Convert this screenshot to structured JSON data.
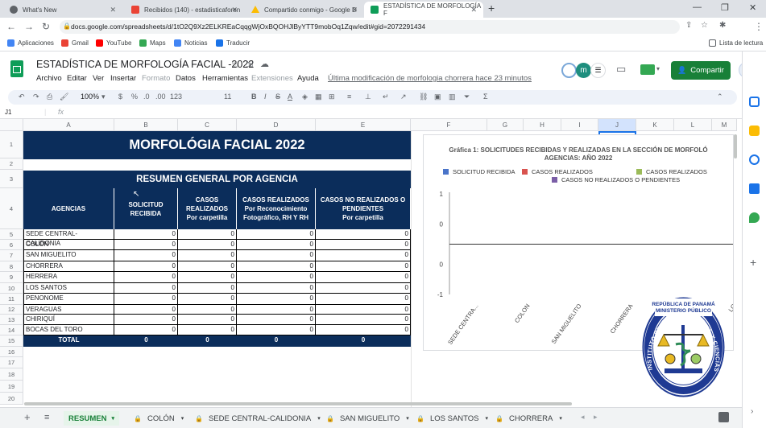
{
  "browser": {
    "tabs": [
      {
        "title": "What's New",
        "color": "#5f6368"
      },
      {
        "title": "Recibidos (140) - estadisticaforen",
        "color": "#ea4335"
      },
      {
        "title": "Compartido conmigo - Google D",
        "color": "#fbbc04"
      },
      {
        "title": "ESTADÍSTICA DE MORFOLOGÍA F",
        "color": "#0f9d58"
      }
    ],
    "url": "docs.google.com/spreadsheets/d/1tO2Q9Xz2ELKREaCqqgWjOxBQOHJlByYTT9mobOq1Zqw/edit#gid=2072291434",
    "bookmarks": [
      "Aplicaciones",
      "Gmail",
      "YouTube",
      "Maps",
      "Noticias",
      "Traducir"
    ],
    "reading_list": "Lista de lectura"
  },
  "sheets": {
    "title": "ESTADÍSTICA DE MORFOLOGÍA FACIAL -2022",
    "menus": [
      "Archivo",
      "Editar",
      "Ver",
      "Insertar",
      "Formato",
      "Datos",
      "Herramientas",
      "Extensiones",
      "Ayuda"
    ],
    "last_modified": "Última modificación de morfologia chorrera hace 23 minutos",
    "share_label": "Compartir",
    "zoom": "100%",
    "font_size": "11",
    "format_num": "123",
    "cell_ref": "J1",
    "fx": "fx"
  },
  "grid": {
    "columns": [
      "A",
      "B",
      "C",
      "D",
      "E",
      "F",
      "G",
      "H",
      "I",
      "J",
      "K",
      "L",
      "M"
    ],
    "rows": [
      "1",
      "2",
      "3",
      "4",
      "5",
      "6",
      "7",
      "8",
      "9",
      "10",
      "11",
      "12",
      "13",
      "14",
      "15",
      "16",
      "17",
      "18",
      "19",
      "20"
    ],
    "main_title": "MORFOLÓGIA FACIAL 2022",
    "summary_title": "RESUMEN GENERAL POR AGENCIA",
    "headers": {
      "agencias": "AGENCIAS",
      "solicitud": [
        "SOLICITUD",
        "RECIBIDA"
      ],
      "casos_realizados": [
        "CASOS",
        "REALIZADOS",
        "Por carpetilla"
      ],
      "casos_reconocimiento": [
        "CASOS REALIZADOS",
        "Por Reconocimiento",
        "Fotográfico, RH Y RH"
      ],
      "no_realizados": [
        "CASOS NO REALIZADOS O",
        "PENDIENTES",
        "Por carpetilla"
      ]
    },
    "agencies": [
      {
        "name": "SEDE CENTRAL- CALIDONIA",
        "v": [
          "0",
          "0",
          "0",
          "0"
        ]
      },
      {
        "name": "COLÓN",
        "v": [
          "0",
          "0",
          "0",
          "0"
        ]
      },
      {
        "name": "SAN MIGUELITO",
        "v": [
          "0",
          "0",
          "0",
          "0"
        ]
      },
      {
        "name": "CHORRERA",
        "v": [
          "0",
          "0",
          "0",
          "0"
        ]
      },
      {
        "name": "HERRERA",
        "v": [
          "0",
          "0",
          "0",
          "0"
        ]
      },
      {
        "name": "LOS SANTOS",
        "v": [
          "0",
          "0",
          "0",
          "0"
        ]
      },
      {
        "name": "PENONOME",
        "v": [
          "0",
          "0",
          "0",
          "0"
        ]
      },
      {
        "name": "VERAGUAS",
        "v": [
          "0",
          "0",
          "0",
          "0"
        ]
      },
      {
        "name": "CHIRIQUÍ",
        "v": [
          "0",
          "0",
          "0",
          "0"
        ]
      },
      {
        "name": "BOCAS DEL TORO",
        "v": [
          "0",
          "0",
          "0",
          "0"
        ]
      }
    ],
    "total": {
      "label": "TOTAL",
      "v": [
        "0",
        "0",
        "0",
        "0"
      ]
    }
  },
  "chart_data": {
    "type": "bar",
    "title": "Gráfica 1: SOLICITUDES RECIBIDAS Y REALIZADAS EN LA SECCIÓN DE MORFOLÓ",
    "subtitle": "AGENCIAS: AÑO 2022",
    "categories": [
      "SEDE CENTRA...",
      "COLON",
      "SAN MIGUELITO",
      "CHORRERA",
      "HERRERA",
      "LO"
    ],
    "series": [
      {
        "name": "SOLICITUD RECIBIDA",
        "color": "#4a74c9",
        "values": [
          0,
          0,
          0,
          0,
          0,
          0
        ]
      },
      {
        "name": "CASOS REALIZADOS",
        "color": "#d9534f",
        "values": [
          0,
          0,
          0,
          0,
          0,
          0
        ]
      },
      {
        "name": "CASOS REALIZADOS",
        "color": "#9bbb59",
        "values": [
          0,
          0,
          0,
          0,
          0,
          0
        ]
      },
      {
        "name": "CASOS NO REALIZADOS O PENDIENTES",
        "color": "#7b5ea7",
        "values": [
          0,
          0,
          0,
          0,
          0,
          0
        ]
      }
    ],
    "yticks": [
      "1",
      "0",
      "0",
      "-1"
    ],
    "ylim": [
      -1,
      1
    ],
    "grid": false,
    "legend": "top"
  },
  "seal": {
    "top": [
      "REPÚBLICA DE PANAMÁ",
      "MINISTERIO PÚBLICO"
    ],
    "ring": "INSTITUTO DE MEDICINA LEGAL Y CIENCIAS FORENSES"
  },
  "sheet_tabs": [
    "RESUMEN",
    "COLÓN",
    "SEDE CENTRAL-CALIDONIA",
    "SAN MIGUELITO",
    "LOS SANTOS",
    "CHORRERA"
  ],
  "colors": {
    "navy": "#0b2d5b",
    "share_green": "#188038"
  }
}
